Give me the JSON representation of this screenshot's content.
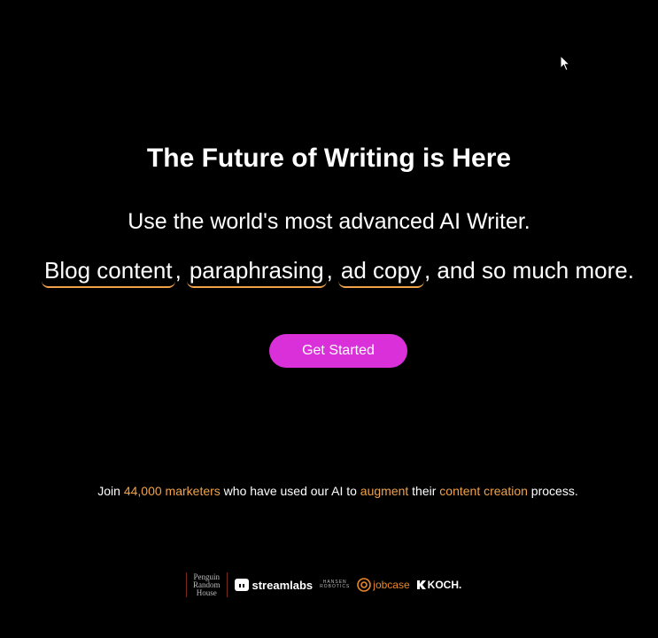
{
  "hero": {
    "title": "The Future of Writing is Here",
    "subtitle": "Use the world's most advanced AI Writer."
  },
  "features": {
    "items": [
      "Blog content",
      "paraphrasing",
      "ad copy"
    ],
    "suffix": ", and so much more.",
    "separator": ","
  },
  "cta": {
    "label": "Get Started"
  },
  "social_proof": {
    "prefix": "Join ",
    "marketers": "44,000 marketers",
    "middle": " who have used our AI to ",
    "augment": "augment",
    "their": " their ",
    "content_creation": "content creation",
    "suffix": " process."
  },
  "logos": {
    "penguin": [
      "Penguin",
      "Random",
      "House"
    ],
    "streamlabs": "streamlabs",
    "hansen": [
      "HANSEN",
      "ROBOTICS"
    ],
    "jobcase": "jobcase",
    "koch": "KOCH."
  },
  "colors": {
    "background": "#000000",
    "accent_orange": "#f0a24a",
    "cta_magenta": "#d930d9"
  },
  "icons": {
    "cursor": "mouse-pointer-icon",
    "streamlabs": "streamlabs-logo-icon",
    "jobcase": "jobcase-at-icon",
    "koch": "koch-k-icon"
  }
}
